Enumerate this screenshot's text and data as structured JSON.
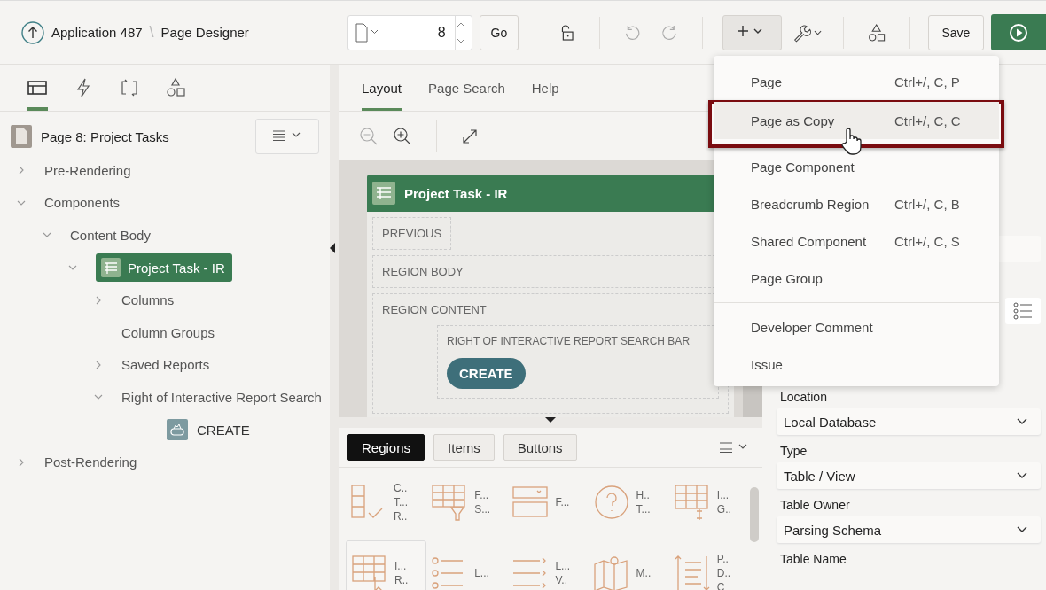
{
  "header": {
    "breadcrumb": [
      "Application 487",
      "Page Designer"
    ],
    "separator": "\\",
    "page_number": "8",
    "go": "Go",
    "save": "Save"
  },
  "left_tabs": [
    {
      "kind": "rendering",
      "selected": true
    },
    {
      "kind": "dynamic",
      "selected": false
    },
    {
      "kind": "processing",
      "selected": false
    },
    {
      "kind": "shared",
      "selected": false
    }
  ],
  "tree": {
    "root": "Page 8: Project Tasks",
    "items": [
      {
        "label": "Pre-Rendering",
        "kind": "node",
        "expanded": false,
        "selected": false
      },
      {
        "label": "Components",
        "kind": "node",
        "expanded": true,
        "selected": false,
        "children": [
          {
            "label": "Content Body",
            "kind": "node",
            "expanded": true,
            "selected": false,
            "children": [
              {
                "label": "Project Task - IR",
                "kind": "region",
                "expanded": true,
                "selected": true,
                "children": [
                  {
                    "label": "Columns",
                    "kind": "node",
                    "expanded": false,
                    "selected": false
                  },
                  {
                    "label": "Column Groups",
                    "kind": "leaf",
                    "selected": false
                  },
                  {
                    "label": "Saved Reports",
                    "kind": "node",
                    "expanded": false,
                    "selected": false
                  },
                  {
                    "label": "Right of Interactive Report Search",
                    "kind": "node",
                    "expanded": true,
                    "selected": false,
                    "children": [
                      {
                        "label": "CREATE",
                        "kind": "button",
                        "selected": false
                      }
                    ]
                  }
                ]
              }
            ]
          }
        ]
      },
      {
        "label": "Post-Rendering",
        "kind": "node",
        "expanded": false,
        "selected": false
      }
    ]
  },
  "center_tabs": [
    {
      "label": "Layout",
      "selected": true
    },
    {
      "label": "Page Search",
      "selected": false
    },
    {
      "label": "Help",
      "selected": false
    }
  ],
  "canvas": {
    "region_title": "Project Task - IR",
    "previous": "PREVIOUS",
    "region_body": "REGION BODY",
    "region_content": "REGION CONTENT",
    "search_bar_slot": "RIGHT OF INTERACTIVE REPORT SEARCH BAR",
    "create_button": "CREATE"
  },
  "gallery": {
    "tabs": [
      {
        "label": "Regions",
        "selected": true
      },
      {
        "label": "Items",
        "selected": false
      },
      {
        "label": "Buttons",
        "selected": false
      }
    ],
    "items": [
      {
        "kind": "table-check",
        "lines": [
          "C..",
          "T...",
          "R.."
        ]
      },
      {
        "kind": "table-filter",
        "lines": [
          "F...",
          "S..."
        ]
      },
      {
        "kind": "form",
        "lines": [
          "F..."
        ]
      },
      {
        "kind": "help",
        "lines": [
          "H..",
          "T..."
        ]
      },
      {
        "kind": "table-group",
        "lines": [
          "I...",
          "G.."
        ]
      },
      {
        "kind": "table-cursor",
        "lines": [
          "I...",
          "R.."
        ]
      },
      {
        "kind": "list",
        "lines": [
          "L..."
        ]
      },
      {
        "kind": "list-arrows",
        "lines": [
          "L...",
          "V.."
        ]
      },
      {
        "kind": "map",
        "lines": [
          "M.."
        ]
      },
      {
        "kind": "text-arrows",
        "lines": [
          "P..",
          "D..",
          "C"
        ]
      }
    ]
  },
  "properties": [
    {
      "label": "Location",
      "value": "Local Database"
    },
    {
      "label": "Type",
      "value": "Table / View"
    },
    {
      "label": "Table Owner",
      "value": "Parsing Schema"
    },
    {
      "label": "Table Name"
    }
  ],
  "menu": {
    "sections": [
      [
        {
          "label": "Page",
          "shortcut": "Ctrl+/, C, P",
          "selected": false,
          "highlighted": false
        },
        {
          "label": "Page as Copy",
          "shortcut": "Ctrl+/, C, C",
          "selected": true,
          "highlighted": true
        },
        {
          "label": "Page Component",
          "selected": false,
          "highlighted": false
        },
        {
          "label": "Breadcrumb Region",
          "shortcut": "Ctrl+/, C, B",
          "selected": false,
          "highlighted": false
        },
        {
          "label": "Shared Component",
          "shortcut": "Ctrl+/, C, S",
          "selected": false,
          "highlighted": false
        },
        {
          "label": "Page Group",
          "selected": false,
          "highlighted": false
        }
      ],
      [
        {
          "label": "Developer Comment",
          "selected": false,
          "highlighted": false
        },
        {
          "label": "Issue",
          "selected": false,
          "highlighted": false
        }
      ]
    ]
  }
}
